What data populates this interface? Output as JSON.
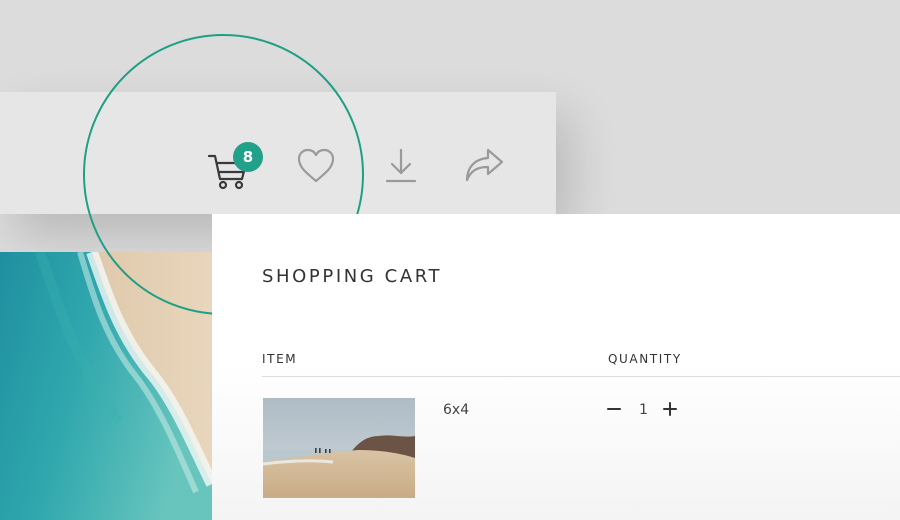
{
  "header": {
    "icons": [
      "cart-icon",
      "heart-icon",
      "download-icon",
      "share-icon"
    ],
    "cart_badge": "8"
  },
  "cart": {
    "title": "SHOPPING CART",
    "columns": {
      "item": "ITEM",
      "quantity": "QUANTITY"
    },
    "items": [
      {
        "size": "6x4",
        "quantity": "1",
        "thumbnail": "beach-photo"
      }
    ]
  },
  "colors": {
    "accent": "#21a08a",
    "highlight_ring": "#1fa085",
    "icon_gray": "#9a9a9a"
  }
}
